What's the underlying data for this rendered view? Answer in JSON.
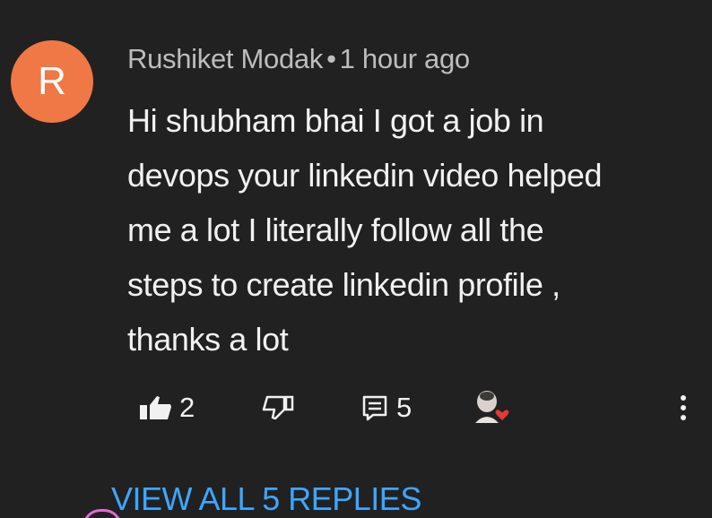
{
  "comment": {
    "avatar_letter": "R",
    "avatar_color": "#f07846",
    "author": "Rushiket Modak",
    "separator": "•",
    "time": "1 hour ago",
    "text": "Hi shubham bhai I got a job in\ndevops your linkedin video helped\nme a lot I literally  follow all the\nsteps to create linkedin profile ,\nthanks a lot",
    "like_count": "2",
    "reply_count": "5",
    "view_replies_label": "VIEW ALL 5 REPLIES",
    "accent_color": "#3ea6ff",
    "heart_color": "#e53935"
  },
  "icons": {
    "like": "thumbs-up-icon",
    "dislike": "thumbs-down-icon",
    "reply": "comment-icon",
    "creator_heart": "creator-heart-avatar",
    "more": "more-vertical-icon"
  }
}
